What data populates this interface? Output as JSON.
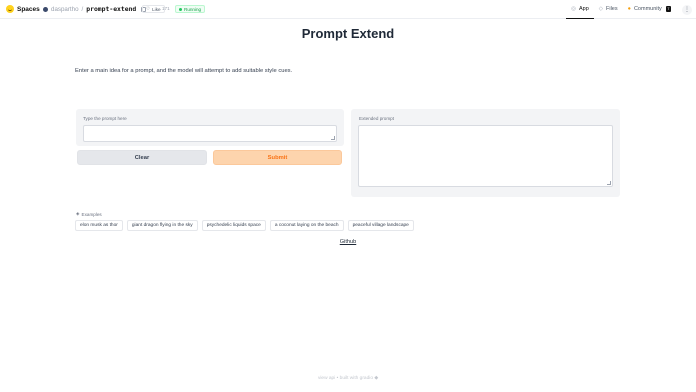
{
  "topbar": {
    "brand": "Spaces",
    "owner": "daspartho",
    "separator": "/",
    "repo": "prompt-extend",
    "like_label": "Like",
    "like_count": "171",
    "status": "Running",
    "tabs": [
      {
        "label": "App",
        "icon": "app-icon"
      },
      {
        "label": "Files",
        "icon": "files-icon"
      },
      {
        "label": "Community",
        "icon": "community-icon",
        "badge": "7"
      }
    ],
    "menu_icon": "more-icon"
  },
  "main": {
    "title": "Prompt Extend",
    "description": "Enter a main idea for a prompt, and the model will attempt to add suitable style cues.",
    "input_label": "Type the prompt here",
    "output_label": "Extended prompt",
    "clear_label": "Clear",
    "submit_label": "Submit",
    "examples_label": "Examples",
    "examples": [
      "elon musk as thor",
      "giant dragon flying in the sky",
      "psychedelic liquids space",
      "a coconut laying on the beach",
      "peaceful village landscape"
    ],
    "github_link": "Github"
  },
  "footer": {
    "api_text": "view api",
    "dot": "•",
    "built_text": "built with gradio"
  },
  "colors": {
    "submit_bg": "#fdd4ad",
    "submit_text": "#f97316",
    "status_green": "#16a34a"
  }
}
